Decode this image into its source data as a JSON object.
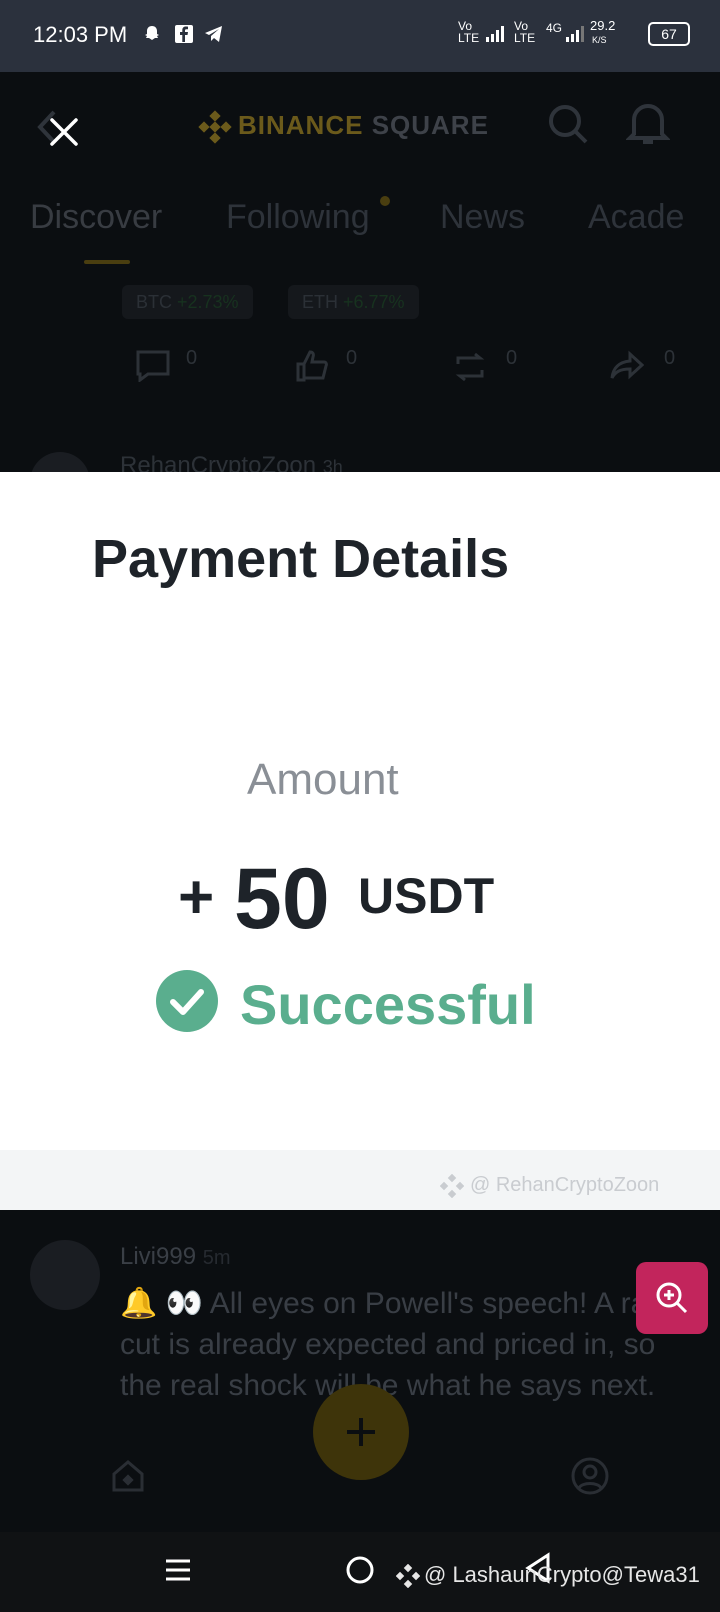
{
  "status_bar": {
    "time": "12:03 PM",
    "net1": "Vo LTE",
    "net2": "Vo LTE",
    "net3": "4G",
    "speed": "29.2",
    "speed_unit": "K/S",
    "battery": "67"
  },
  "background_app": {
    "logo_brand": "BINANCE",
    "logo_suffix": "SQUARE",
    "tabs": [
      "Discover",
      "Following",
      "News",
      "Acade"
    ],
    "tickers": [
      {
        "symbol": "BTC",
        "change": "+2.73%"
      },
      {
        "symbol": "ETH",
        "change": "+6.77%"
      }
    ],
    "actions": {
      "comments": "0",
      "likes": "0",
      "reposts": "0",
      "shares": "0"
    },
    "prev_author": "RehanCryptoZoon",
    "prev_time": "3h",
    "post": {
      "author": "Livi999",
      "time": "5m",
      "text": "🔔 👀 All eyes on Powell's speech! A rate cut is already expected and priced in, so the real shock will be what he says next. Every word could influence the"
    }
  },
  "modal": {
    "title": "Payment Details",
    "amount_label": "Amount",
    "amount_sign": "+",
    "amount_value": "50",
    "amount_unit": "USDT",
    "status": "Successful",
    "watermark": "@ RehanCryptoZoon"
  },
  "footer_watermark": "@ LashaunCrypto@Tewa31",
  "colors": {
    "success": "#5aae8e",
    "brand_yellow": "#f0b90b",
    "zoom_button": "#c2255c"
  }
}
